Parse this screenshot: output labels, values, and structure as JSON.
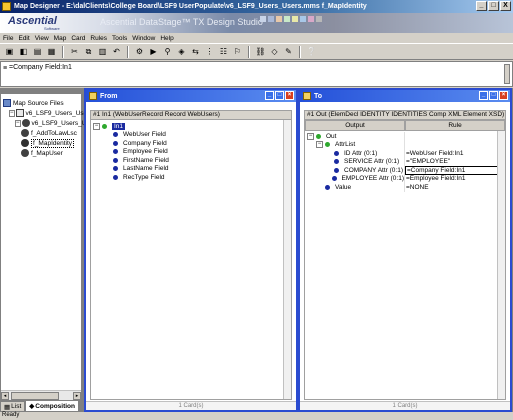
{
  "window": {
    "title": "Map Designer - E:\\dalClients\\College Board\\LSF9 UserPopulate\\v6_LSF9_Users_Users.mms f_MapIdentity",
    "controls": [
      "_",
      "□",
      "X"
    ]
  },
  "banner": {
    "logo": "Ascential",
    "logo_sub": "Software",
    "product": "Ascential DataStage™ TX Design Studio",
    "mosaic_colors": [
      "#c8d4e8",
      "#a8b8d8",
      "#e8c8a8",
      "#c8e8c8",
      "#e8e8a8",
      "#a8c8e8",
      "#d8a8c8",
      "#b8b8b8"
    ]
  },
  "menubar": [
    "File",
    "Edit",
    "View",
    "Map",
    "Card",
    "Rules",
    "Tools",
    "Window",
    "Help"
  ],
  "toolbar": {
    "icons": [
      "new-icon",
      "open-icon",
      "save-icon",
      "print-icon",
      "cut-icon",
      "copy-icon",
      "paste-icon",
      "undo-icon",
      "build-icon",
      "run-icon",
      "search-icon",
      "navigate-icon",
      "compare-icon",
      "trace-icon",
      "schema-icon",
      "organizer-icon",
      "link-icon",
      "unlink-icon",
      "properties-icon",
      "help-icon"
    ],
    "glyphs": [
      "▣",
      "◧",
      "▤",
      "▦",
      "✂",
      "⧉",
      "▥",
      "↶",
      "⚙",
      "▶",
      "⚲",
      "◈",
      "⇆",
      "⋮",
      "☷",
      "⚐",
      "⛓",
      "◇",
      "✎",
      "❔"
    ]
  },
  "rulebar": {
    "value": "=Company Field:In1"
  },
  "navigator": {
    "items": [
      {
        "label": "Map Source Files",
        "indent": 0,
        "icon": "files",
        "expander": ""
      },
      {
        "label": "v6_LSF9_Users_Users",
        "indent": 1,
        "icon": "file",
        "expander": "−"
      },
      {
        "label": "v6_LSF9_Users_Us",
        "indent": 2,
        "icon": "map",
        "expander": "−"
      },
      {
        "label": "f_AddToLawLsc",
        "indent": 3,
        "icon": "map",
        "expander": ""
      },
      {
        "label": "f_MapIdentity",
        "indent": 3,
        "icon": "mapsel",
        "expander": "",
        "selected": true
      },
      {
        "label": "f_MapUser",
        "indent": 3,
        "icon": "map",
        "expander": ""
      }
    ],
    "tabs": [
      {
        "label": "List",
        "active": false
      },
      {
        "label": "Composition",
        "active": true
      }
    ]
  },
  "from_panel": {
    "title": "From",
    "card_title": "#1 In1 (WebUserRecord Record WebUsers)",
    "root_label": "In1",
    "fields": [
      "WebUser Field",
      "Company Field",
      "Employee Field",
      "FirstName Field",
      "LastName Field",
      "RecType Field"
    ],
    "footer": "1 Card(s)"
  },
  "to_panel": {
    "title": "To",
    "card_title": "#1 Out (ElemDecl IDENTITY IDENTITIES Comp XML Element XSD)",
    "col_output": "Output",
    "col_rule": "Rule",
    "rows": [
      {
        "label": "Out",
        "indent": 0,
        "dot": "green",
        "expander": "−",
        "rule": ""
      },
      {
        "label": "AttrList",
        "indent": 1,
        "dot": "green",
        "expander": "−",
        "rule": ""
      },
      {
        "label": "ID Attr (0:1)",
        "indent": 2,
        "dot": "blue",
        "expander": "",
        "rule": "=WebUser Field:In1"
      },
      {
        "label": "SERVICE Attr (0:1)",
        "indent": 2,
        "dot": "blue",
        "expander": "",
        "rule": "=\"EMPLOYEE\""
      },
      {
        "label": "COMPANY Attr (0:1)",
        "indent": 2,
        "dot": "blue",
        "expander": "",
        "rule": "=Company Field:In1",
        "active": true
      },
      {
        "label": "EMPLOYEE Attr (0:1)",
        "indent": 2,
        "dot": "blue",
        "expander": "",
        "rule": "=Employee Field:In1"
      },
      {
        "label": "Value",
        "indent": 1,
        "dot": "blue",
        "expander": "",
        "rule": "=NONE"
      }
    ],
    "footer": "1 Card(s)"
  },
  "status": "Ready"
}
